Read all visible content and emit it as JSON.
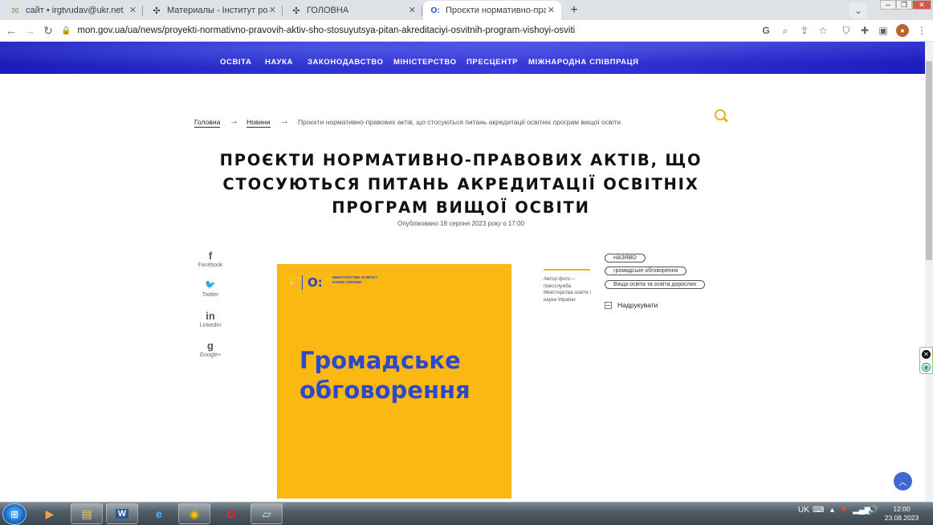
{
  "browser": {
    "tabs": [
      {
        "title": "сайт • irgtvudav@ukr.net",
        "icon": "mail-icon",
        "active": false
      },
      {
        "title": "Материалы - Інститут розведення",
        "icon": "joomla-icon",
        "active": false
      },
      {
        "title": "ГОЛОВНА",
        "icon": "joomla-icon",
        "active": false
      },
      {
        "title": "Проєкти нормативно-правових",
        "icon": "mon-logo-icon",
        "active": true
      }
    ],
    "new_tab": "+",
    "url": "mon.gov.ua/ua/news/proyekti-normativno-pravovih-aktiv-sho-stosuyutsya-pitan-akreditaciyi-osvitnih-program-vishoyi-osviti"
  },
  "site": {
    "nav": [
      "ОСВІТА",
      "НАУКА",
      "ЗАКОНОДАВСТВО",
      "МІНІСТЕРСТВО",
      "ПРЕСЦЕНТР",
      "МІЖНАРОДНА СПІВПРАЦЯ"
    ],
    "breadcrumb": {
      "home": "Головна",
      "news": "Новини",
      "current": "Проєкти нормативно-правових актів, що стосуються питань акредитації освітніх програм вищої освіти"
    },
    "title": "ПРОЄКТИ НОРМАТИВНО-ПРАВОВИХ АКТІВ, ЩО СТОСУЮТЬСЯ ПИТАНЬ АКРЕДИТАЦІЇ ОСВІТНІХ ПРОГРАМ ВИЩОЇ ОСВІТИ",
    "published": "Опубліковано 18 серпня 2023 року о 17:00",
    "share": [
      {
        "icon": "facebook-icon",
        "glyph": "f",
        "label": "Facebook"
      },
      {
        "icon": "twitter-icon",
        "glyph": "🐦",
        "label": "Twitter"
      },
      {
        "icon": "linkedin-icon",
        "glyph": "in",
        "label": "LinkedIn"
      },
      {
        "icon": "googleplus-icon",
        "glyph": "g",
        "label": "Google+"
      }
    ],
    "poster": {
      "logo_mark": "О:",
      "logo_text": "Міністерство освіти і науки України",
      "title": "Громадське обговорення",
      "background": "#fbb813",
      "text_color": "#2d48cc"
    },
    "caption": "Автор фото – пресслужба Міністерства освіти і науки України",
    "tags": [
      "НАЗЯВО",
      "громадське обговорення",
      "Вища освіта та освіта дорослих"
    ],
    "print_label": "Надрукувати",
    "accent": "#e8b325",
    "banner_color": "#2a2fc8"
  },
  "taskbar": {
    "tray_lang": "UK",
    "time": "12:00",
    "date": "23.08.2023"
  }
}
